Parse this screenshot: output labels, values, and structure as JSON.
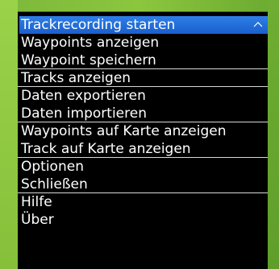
{
  "menu": {
    "items": [
      {
        "label": "Trackrecording starten"
      },
      {
        "label": "Waypoints anzeigen"
      },
      {
        "label": "Waypoint speichern"
      },
      {
        "label": "Tracks anzeigen"
      },
      {
        "label": "Daten exportieren"
      },
      {
        "label": "Daten importieren"
      },
      {
        "label": "Waypoints auf Karte anzeigen"
      },
      {
        "label": "Track auf Karte anzeigen"
      },
      {
        "label": "Optionen"
      },
      {
        "label": "Schließen"
      },
      {
        "label": "Hilfe"
      },
      {
        "label": "Über"
      }
    ],
    "selected_index": 0,
    "scroll_indicator_icon": "chevron-up-icon"
  },
  "colors": {
    "selection": "#1f6ad8",
    "background": "#000000",
    "separator": "#d8d8d8",
    "wallpaper": "#8cc63e"
  }
}
